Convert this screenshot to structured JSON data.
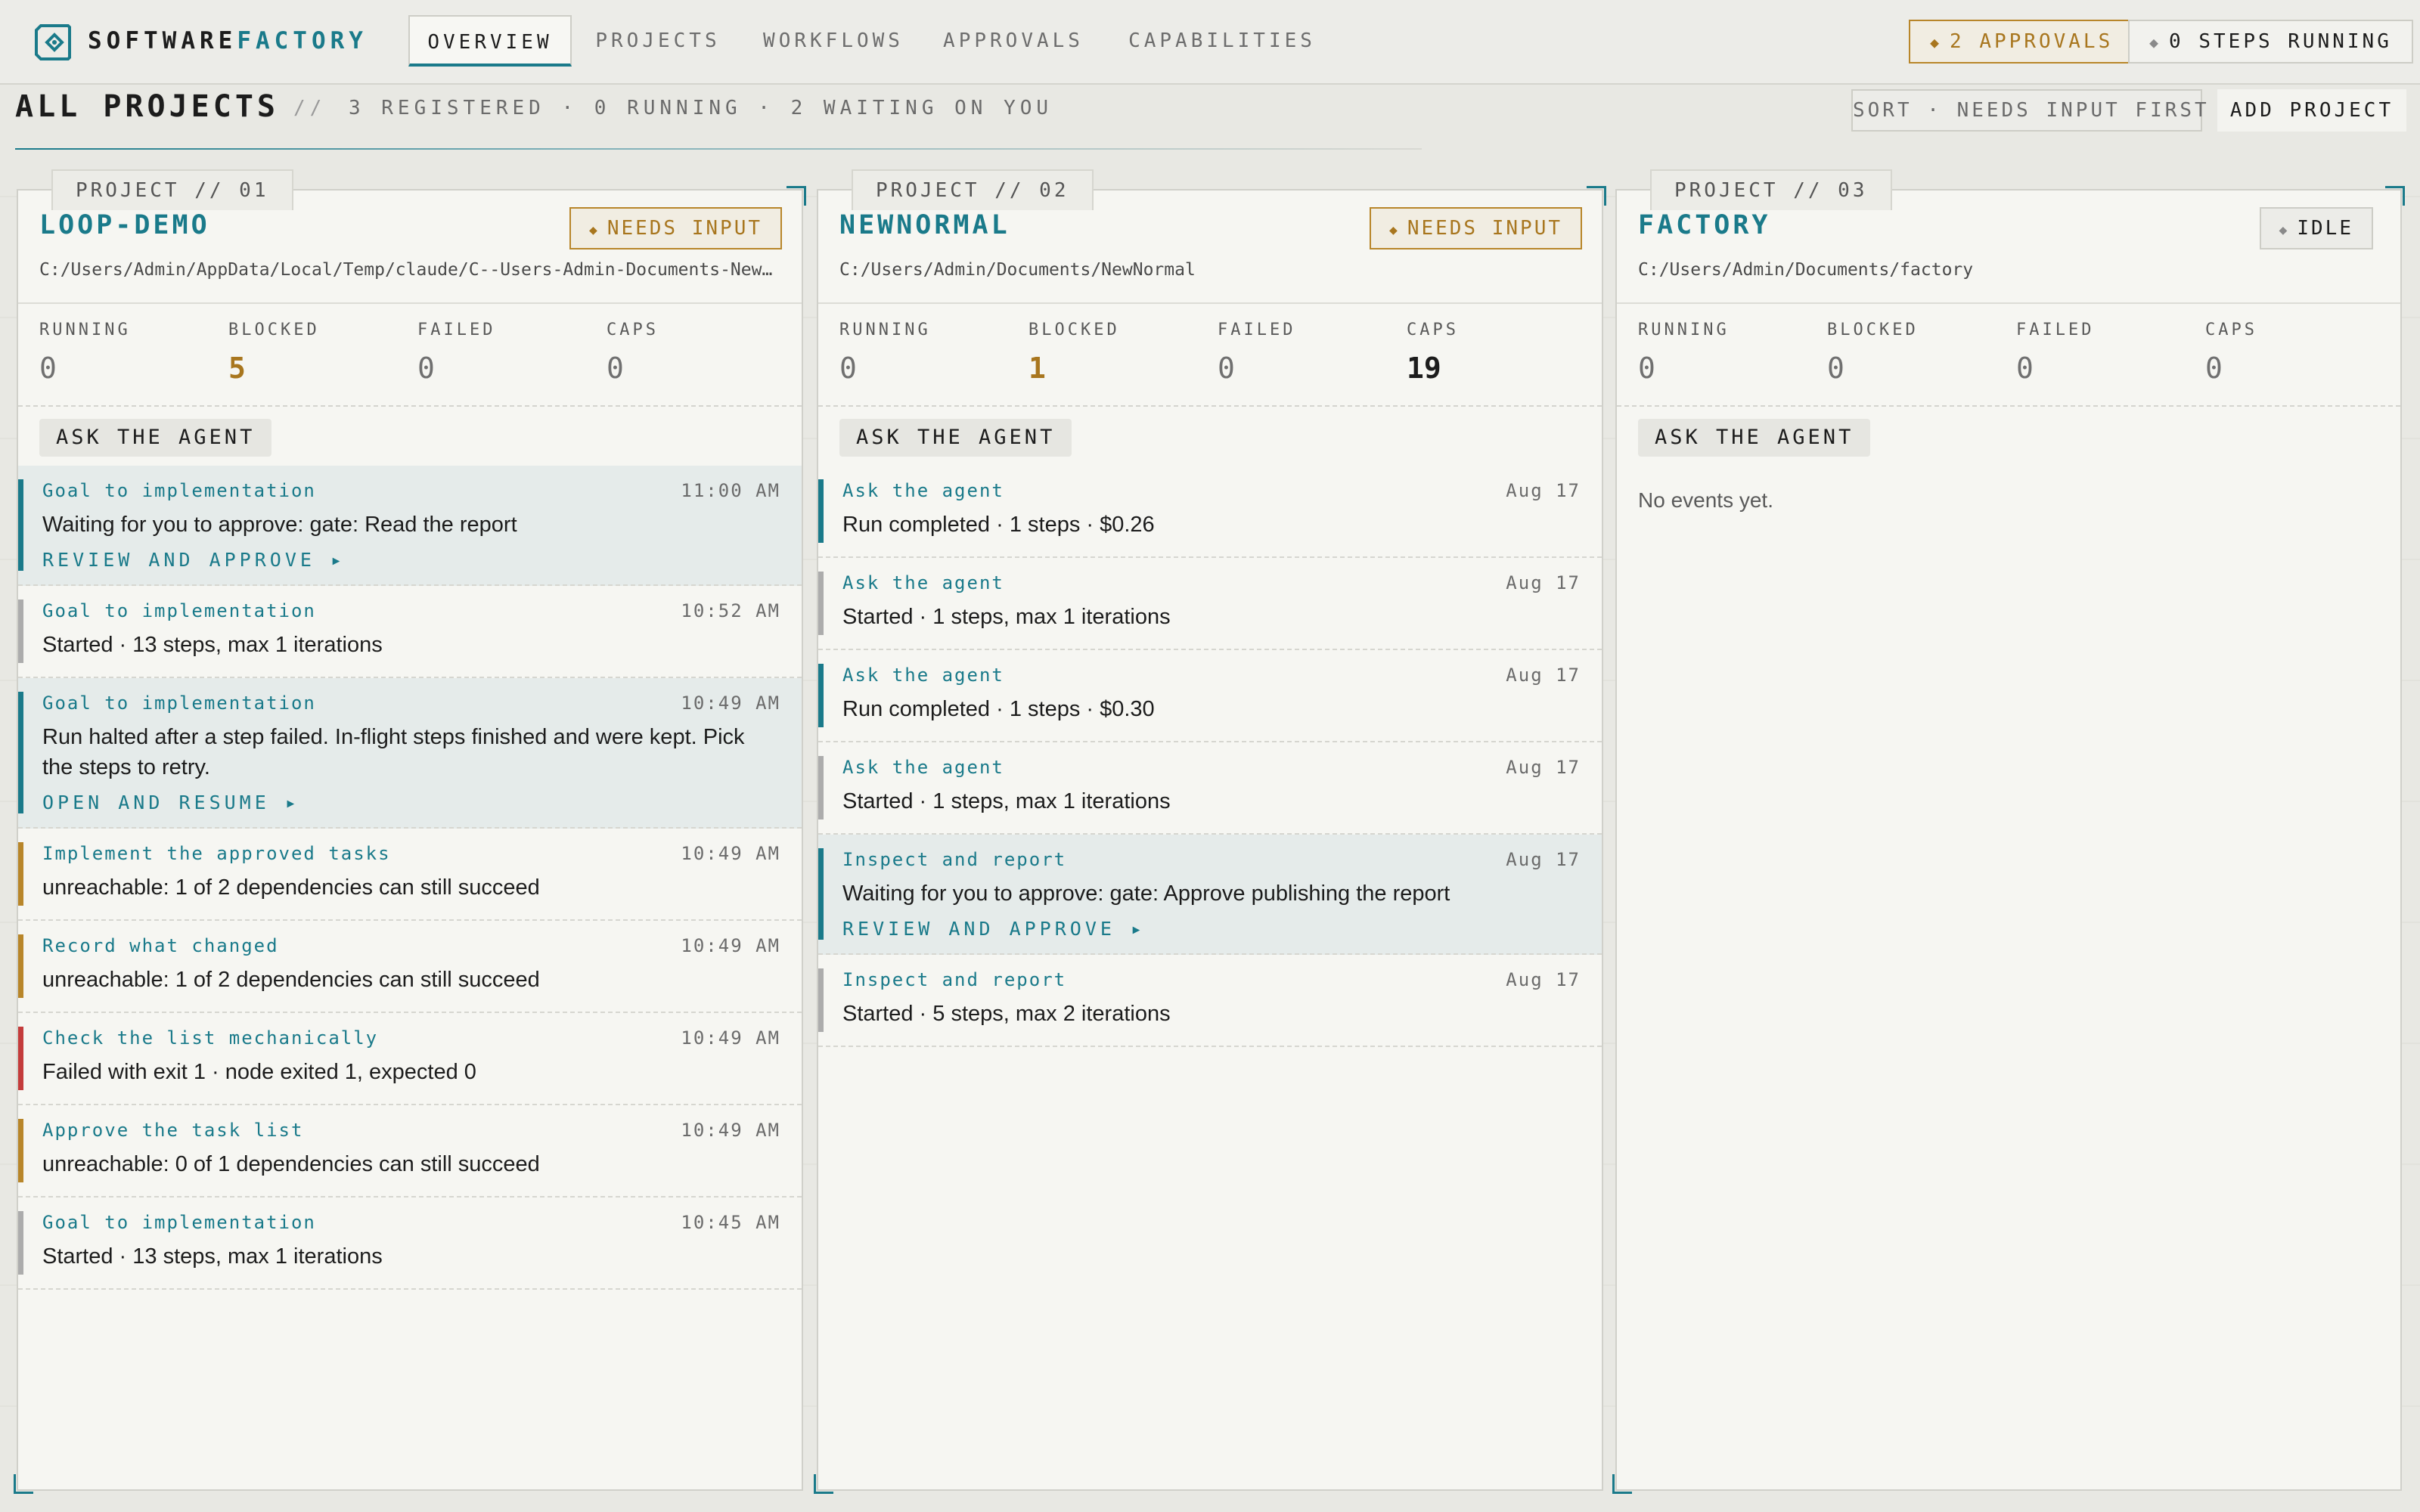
{
  "app": {
    "brand_primary": "SOFTWARE",
    "brand_accent": "FACTORY",
    "accent_color": "#1a7a8a",
    "warn_color": "#b8862a"
  },
  "nav": {
    "tabs": [
      {
        "label": "OVERVIEW",
        "active": true
      },
      {
        "label": "PROJECTS",
        "active": false
      },
      {
        "label": "WORKFLOWS",
        "active": false
      },
      {
        "label": "APPROVALS",
        "active": false
      },
      {
        "label": "CAPABILITIES",
        "active": false
      }
    ],
    "approvals_pill": "2 APPROVALS",
    "steps_pill": "0 STEPS RUNNING"
  },
  "header": {
    "title": "ALL PROJECTS",
    "separator": "//",
    "subtitle": "3 REGISTERED · 0 RUNNING · 2 WAITING ON YOU",
    "sort_label": "SORT · NEEDS INPUT FIRST",
    "add_label": "ADD PROJECT"
  },
  "projects": [
    {
      "tag": "PROJECT // 01",
      "name": "LOOP-DEMO",
      "status": "NEEDS INPUT",
      "path": "C:/Users/Admin/AppData/Local/Temp/claude/C--Users-Admin-Documents-NewNormal",
      "stats": [
        {
          "label": "RUNNING",
          "value": "0"
        },
        {
          "label": "BLOCKED",
          "value": "5"
        },
        {
          "label": "FAILED",
          "value": "0"
        },
        {
          "label": "CAPS",
          "value": "0"
        }
      ],
      "ask_label": "ASK THE AGENT",
      "events": [
        {
          "title": "Goal to implementation",
          "time": "11:00 AM",
          "message": "Waiting for you to approve: gate: Read the report",
          "action": "REVIEW AND APPROVE ▸",
          "bar": "teal",
          "highlight": true
        },
        {
          "title": "Goal to implementation",
          "time": "10:52 AM",
          "message": "Started · 13 steps, max 1 iterations",
          "bar": "grey"
        },
        {
          "title": "Goal to implementation",
          "time": "10:49 AM",
          "message": "Run halted after a step failed. In-flight steps finished and were kept. Pick the steps to retry.",
          "action": "OPEN AND RESUME ▸",
          "bar": "teal",
          "highlight": true
        },
        {
          "title": "Implement the approved tasks",
          "time": "10:49 AM",
          "message": "unreachable: 1 of 2 dependencies can still succeed",
          "bar": "amber"
        },
        {
          "title": "Record what changed",
          "time": "10:49 AM",
          "message": "unreachable: 1 of 2 dependencies can still succeed",
          "bar": "amber"
        },
        {
          "title": "Check the list mechanically",
          "time": "10:49 AM",
          "message": "Failed with exit 1 · node exited 1, expected 0",
          "bar": "red"
        },
        {
          "title": "Approve the task list",
          "time": "10:49 AM",
          "message": "unreachable: 0 of 1 dependencies can still succeed",
          "bar": "amber"
        },
        {
          "title": "Goal to implementation",
          "time": "10:45 AM",
          "message": "Started · 13 steps, max 1 iterations",
          "bar": "grey"
        }
      ]
    },
    {
      "tag": "PROJECT // 02",
      "name": "NEWNORMAL",
      "status": "NEEDS INPUT",
      "path": "C:/Users/Admin/Documents/NewNormal",
      "stats": [
        {
          "label": "RUNNING",
          "value": "0"
        },
        {
          "label": "BLOCKED",
          "value": "1"
        },
        {
          "label": "FAILED",
          "value": "0"
        },
        {
          "label": "CAPS",
          "value": "19"
        }
      ],
      "ask_label": "ASK THE AGENT",
      "events": [
        {
          "title": "Ask the agent",
          "time": "Aug 17",
          "message": "Run completed · 1 steps · $0.26",
          "bar": "teal"
        },
        {
          "title": "Ask the agent",
          "time": "Aug 17",
          "message": "Started · 1 steps, max 1 iterations",
          "bar": "grey"
        },
        {
          "title": "Ask the agent",
          "time": "Aug 17",
          "message": "Run completed · 1 steps · $0.30",
          "bar": "teal"
        },
        {
          "title": "Ask the agent",
          "time": "Aug 17",
          "message": "Started · 1 steps, max 1 iterations",
          "bar": "grey"
        },
        {
          "title": "Inspect and report",
          "time": "Aug 17",
          "message": "Waiting for you to approve: gate: Approve publishing the report",
          "action": "REVIEW AND APPROVE ▸",
          "bar": "teal",
          "highlight": true
        },
        {
          "title": "Inspect and report",
          "time": "Aug 17",
          "message": "Started · 5 steps, max 2 iterations",
          "bar": "grey"
        }
      ]
    },
    {
      "tag": "PROJECT // 03",
      "name": "FACTORY",
      "status": "IDLE",
      "path": "C:/Users/Admin/Documents/factory",
      "stats": [
        {
          "label": "RUNNING",
          "value": "0"
        },
        {
          "label": "BLOCKED",
          "value": "0"
        },
        {
          "label": "FAILED",
          "value": "0"
        },
        {
          "label": "CAPS",
          "value": "0"
        }
      ],
      "ask_label": "ASK THE AGENT",
      "events": [],
      "empty_text": "No events yet."
    }
  ]
}
